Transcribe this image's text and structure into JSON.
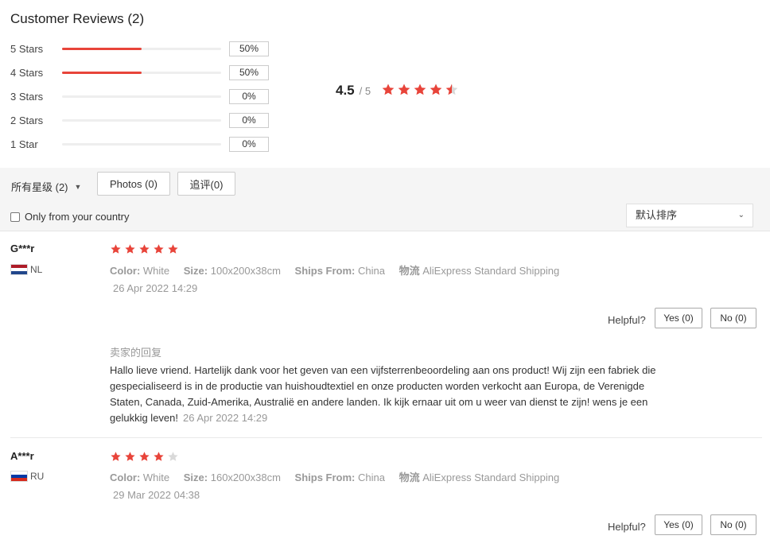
{
  "title": "Customer Reviews (2)",
  "distribution": [
    {
      "label": "5 Stars",
      "percent": 50,
      "percent_text": "50%"
    },
    {
      "label": "4 Stars",
      "percent": 50,
      "percent_text": "50%"
    },
    {
      "label": "3 Stars",
      "percent": 0,
      "percent_text": "0%"
    },
    {
      "label": "2 Stars",
      "percent": 0,
      "percent_text": "0%"
    },
    {
      "label": "1 Star",
      "percent": 0,
      "percent_text": "0%"
    }
  ],
  "average": {
    "score": "4.5",
    "total": "/ 5",
    "stars": 4.5
  },
  "filters": {
    "all_ratings": "所有星级 (2)",
    "photos": "Photos (0)",
    "additional": "追评(0)",
    "country": "Only from your country",
    "sort": "默认排序"
  },
  "colors": {
    "accent": "#e8443a",
    "star_empty": "#d9d9d9"
  },
  "attr_labels": {
    "color": "Color:",
    "size": "Size:",
    "ships_from": "Ships From:",
    "logistics": "物流"
  },
  "reviews": [
    {
      "user": "G***r",
      "country": "NL",
      "rating": 5,
      "color": "White",
      "size": "100x200x38cm",
      "ships_from": "China",
      "logistics": "AliExpress Standard Shipping",
      "date": "26 Apr 2022 14:29",
      "helpful": "Helpful?",
      "yes": "Yes (0)",
      "no": "No (0)",
      "reply_title": "卖家的回复",
      "reply_text": "Hallo lieve vriend. Hartelijk dank voor het geven van een vijfsterrenbeoordeling aan ons product! Wij zijn een fabriek die gespecialiseerd is in de productie van huishoudtextiel en onze producten worden verkocht aan Europa, de Verenigde Staten, Canada, Zuid-Amerika, Australië en andere landen. Ik kijk ernaar uit om u weer van dienst te zijn! wens je een gelukkig leven!",
      "reply_date": "26 Apr 2022 14:29"
    },
    {
      "user": "A***r",
      "country": "RU",
      "rating": 4,
      "color": "White",
      "size": "160x200x38cm",
      "ships_from": "China",
      "logistics": "AliExpress Standard Shipping",
      "date": "29 Mar 2022 04:38",
      "helpful": "Helpful?",
      "yes": "Yes (0)",
      "no": "No (0)"
    }
  ]
}
